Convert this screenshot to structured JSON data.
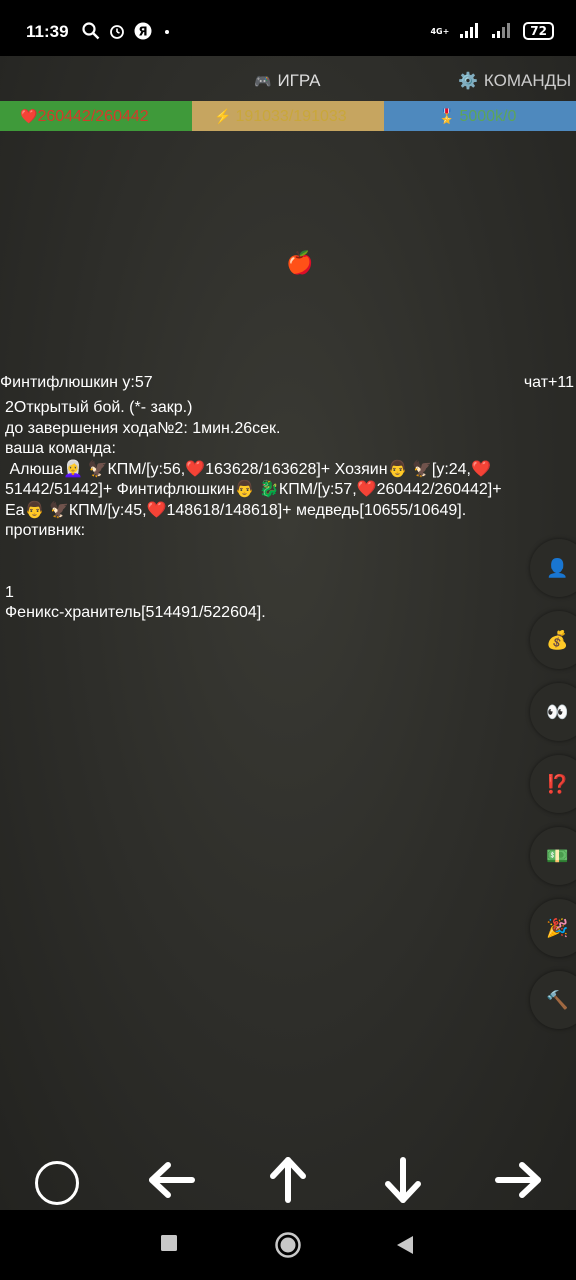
{
  "status_bar": {
    "time": "11:39",
    "left_icons": [
      "search-icon",
      "alarm-icon",
      "yandex-icon",
      "dot-icon"
    ],
    "network": "4G+",
    "battery": "72"
  },
  "nav": {
    "game_icon": "🎮",
    "game_label": "ИГРА",
    "teams_icon": "⚙️",
    "teams_label": "КОМАНДЫ"
  },
  "stats": {
    "hp_icon": "❤️",
    "hp": "260442/260442",
    "energy_icon": "⚡",
    "energy": "191033/191033",
    "medal_icon": "🎖️",
    "xp": "5000k/0"
  },
  "colors": {
    "hp_bar": "#3f9a3a",
    "energy_bar": "#c6a560",
    "xp_bar": "#4e89be",
    "hp_text": "#d33b2a"
  },
  "map": {
    "apple_icon": "🍎"
  },
  "info": {
    "player": "Финтифлюшкин  у:57",
    "chat": "чат+11"
  },
  "battle": {
    "line1": "2Открытый бой. (*- закр.)",
    "line2": "до завершения хода№2: 1мин.26сек.",
    "line3": "ваша команда:",
    "team": " Алюша👩‍🦳 🦅КПМ/[у:56,❤️163628/163628]+ Хозяин👨 🦅[у:24,❤️51442/51442]+ Финтифлюшкин👨 🐉КПМ/[у:57,❤️260442/260442]+ Еа👨 🦅КПМ/[у:45,❤️148618/148618]+ медведь[10655/10649].",
    "line4": "противник:",
    "enemy_count": "1",
    "enemy": "Феникс-хранитель[514491/522604]."
  },
  "side_buttons": [
    {
      "name": "profile-icon",
      "icon": "👤"
    },
    {
      "name": "money-bag-icon",
      "icon": "💰"
    },
    {
      "name": "eyes-icon",
      "icon": "👀"
    },
    {
      "name": "interrobang-icon",
      "icon": "⁉️"
    },
    {
      "name": "banknote-icon",
      "icon": "💵"
    },
    {
      "name": "party-popper-icon",
      "icon": "🎉"
    },
    {
      "name": "hammer-icon",
      "icon": "🔨"
    }
  ]
}
